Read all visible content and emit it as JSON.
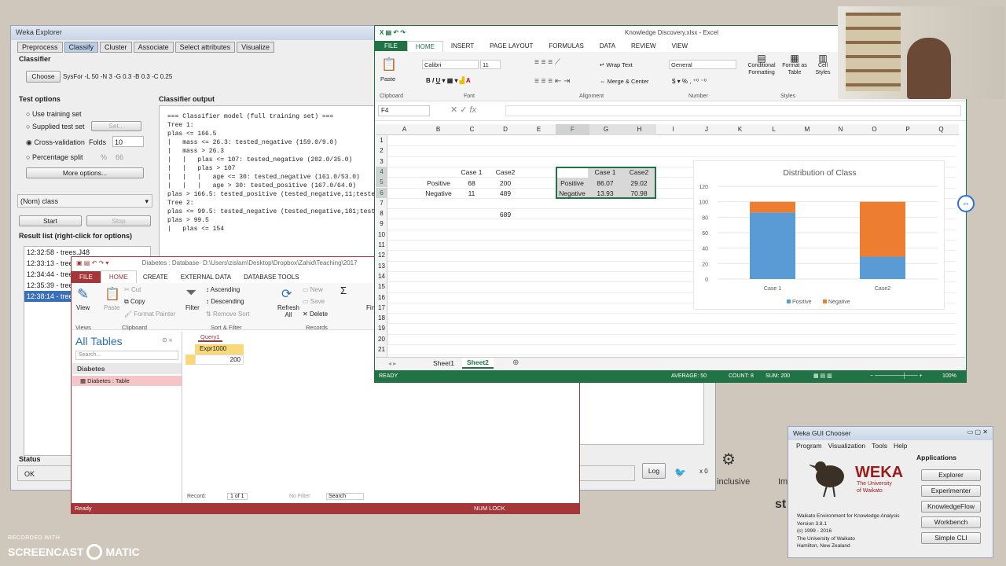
{
  "weka_explorer": {
    "title": "Weka Explorer",
    "tabs": [
      "Preprocess",
      "Classify",
      "Cluster",
      "Associate",
      "Select attributes",
      "Visualize"
    ],
    "classifier_label": "Classifier",
    "choose_btn": "Choose",
    "classifier_value": "SysFor -L 50 -N 3 -G 0.3 -B 0.3 -C 0.25",
    "test_options_label": "Test options",
    "opt_training": "Use training set",
    "opt_supplied": "Supplied test set",
    "set_btn": "Set...",
    "opt_cv": "Cross-validation",
    "folds_label": "Folds",
    "folds_value": "10",
    "opt_split": "Percentage split",
    "pct": "%",
    "pct_value": "66",
    "more_options": "More options...",
    "class_select": "(Nom) class",
    "start_btn": "Start",
    "stop_btn": "Stop",
    "result_list_label": "Result list (right-click for options)",
    "results": [
      "12:32:58 - trees.J48",
      "12:33:13 - trees",
      "12:34:44 - trees",
      "12:35:39 - trees",
      "12:38:14 - trees"
    ],
    "output_label": "Classifier output",
    "output_lines": [
      "=== Classifier model (full training set) ===",
      "",
      "Tree 1:",
      "plas <= 166.5",
      "|   mass <= 26.3: tested_negative (159.0/9.0)",
      "|   mass > 26.3",
      "|   |   plas <= 107: tested_negative (202.0/35.0)",
      "|   |   plas > 107",
      "|   |   |   age <= 30: tested_negative (161.0/53.0)",
      "|   |   |   age > 30: tested_positive (167.0/64.0)",
      "plas > 166.5: tested_positive (tested_negative,11;tested_",
      "",
      "Tree 2:",
      "plas <= 99.5: tested_negative (tested_negative,181;tested_",
      "plas > 99.5",
      "|   plas <= 154"
    ],
    "status_label": "Status",
    "status_value": "OK",
    "log_btn": "Log",
    "x0": "x 0"
  },
  "excel": {
    "title": "Knowledge Discovery.xlsx - Excel",
    "menu": [
      "FILE",
      "HOME",
      "INSERT",
      "PAGE LAYOUT",
      "FORMULAS",
      "DATA",
      "REVIEW",
      "VIEW"
    ],
    "font_name": "Calibri",
    "font_size": "11",
    "wrap_text": "Wrap Text",
    "merge_center": "Merge & Center",
    "number_format": "General",
    "cond_fmt": "Conditional Formatting",
    "fmt_table": "Format as Table",
    "cell_styles": "Cell Styles",
    "paste": "Paste",
    "groups": [
      "Clipboard",
      "Font",
      "Alignment",
      "Number",
      "Styles"
    ],
    "name_box": "F4",
    "columns": [
      "A",
      "B",
      "C",
      "D",
      "E",
      "F",
      "G",
      "H",
      "I",
      "J",
      "K",
      "L",
      "M",
      "N",
      "O",
      "P",
      "Q"
    ],
    "rows": [
      "1",
      "2",
      "3",
      "4",
      "5",
      "6",
      "7",
      "8",
      "9",
      "10",
      "11",
      "12",
      "13",
      "14",
      "15",
      "16",
      "17",
      "18",
      "19",
      "20",
      "21"
    ],
    "t1_headers": [
      "Case 1",
      "Case2"
    ],
    "t1_rows": [
      [
        "Positive",
        "68",
        "200"
      ],
      [
        "Negative",
        "11",
        "489"
      ]
    ],
    "d8": "689",
    "t2_headers": [
      "Case 1",
      "Case2"
    ],
    "t2_rows": [
      [
        "Positive",
        "86.07",
        "29.02"
      ],
      [
        "Negative",
        "13.93",
        "70.98"
      ]
    ],
    "sheets": [
      "Sheet1",
      "Sheet2"
    ],
    "status_ready": "READY",
    "average": "AVERAGE: 50",
    "count": "COUNT: 8",
    "sum": "SUM: 200",
    "zoom": "100%"
  },
  "chart_data": {
    "type": "bar",
    "stacked": true,
    "title": "Distribution of Class",
    "categories": [
      "Case 1",
      "Case2"
    ],
    "series": [
      {
        "name": "Positive",
        "values": [
          86.07,
          29.02
        ],
        "color": "#5b9bd5"
      },
      {
        "name": "Negative",
        "values": [
          13.93,
          70.98
        ],
        "color": "#ed7d31"
      }
    ],
    "ylim": [
      0,
      120
    ],
    "yticks": [
      "120",
      "100",
      "80",
      "60",
      "40",
      "20",
      "0"
    ],
    "legend": "bottom"
  },
  "access": {
    "title": "Diabetes : Database- D:\\Users\\zislam\\Desktop\\Dropbox\\Zahid\\Teaching\\2017",
    "menu": [
      "FILE",
      "HOME",
      "CREATE",
      "EXTERNAL DATA",
      "DATABASE TOOLS"
    ],
    "view": "View",
    "paste": "Paste",
    "cut": "Cut",
    "copy": "Copy",
    "format_painter": "Format Painter",
    "filter": "Filter",
    "ascending": "Ascending",
    "descending": "Descending",
    "remove_sort": "Remove Sort",
    "refresh": "Refresh All",
    "new": "New",
    "save": "Save",
    "delete": "Delete",
    "find": "Fin",
    "groups": [
      "Views",
      "Clipboard",
      "Sort & Filter",
      "Records"
    ],
    "nav_title": "All Tables",
    "search": "Search...",
    "group": "Diabetes",
    "table_item": "Diabetes : Table",
    "query_tab": "Query1",
    "col_header": "Expr1000",
    "value": "200",
    "record_label": "Record:",
    "record_pos": "1 of 1",
    "no_filter": "No Filter",
    "search_box": "Search",
    "status": "Ready",
    "numlock": "NUM LOCK"
  },
  "chooser": {
    "title": "Weka GUI Chooser",
    "menu": [
      "Program",
      "Visualization",
      "Tools",
      "Help"
    ],
    "apps_label": "Applications",
    "buttons": [
      "Explorer",
      "Experimenter",
      "KnowledgeFlow",
      "Workbench",
      "Simple CLI"
    ],
    "weka": "WEKA",
    "uni1": "The University",
    "uni2": "of Waikato",
    "info": [
      "Waikato Environment for Knowledge Analysis",
      "Version 3.8.1",
      "(c) 1999 - 2016",
      "The University of Waikato",
      "Hamilton, New Zealand"
    ]
  },
  "desktop": {
    "inclusive": "inclusive",
    "im": "Im",
    "st": "st",
    "recorded_with": "RECORDED WITH",
    "screencast": "SCREENCAST",
    "matic": "MATIC"
  }
}
